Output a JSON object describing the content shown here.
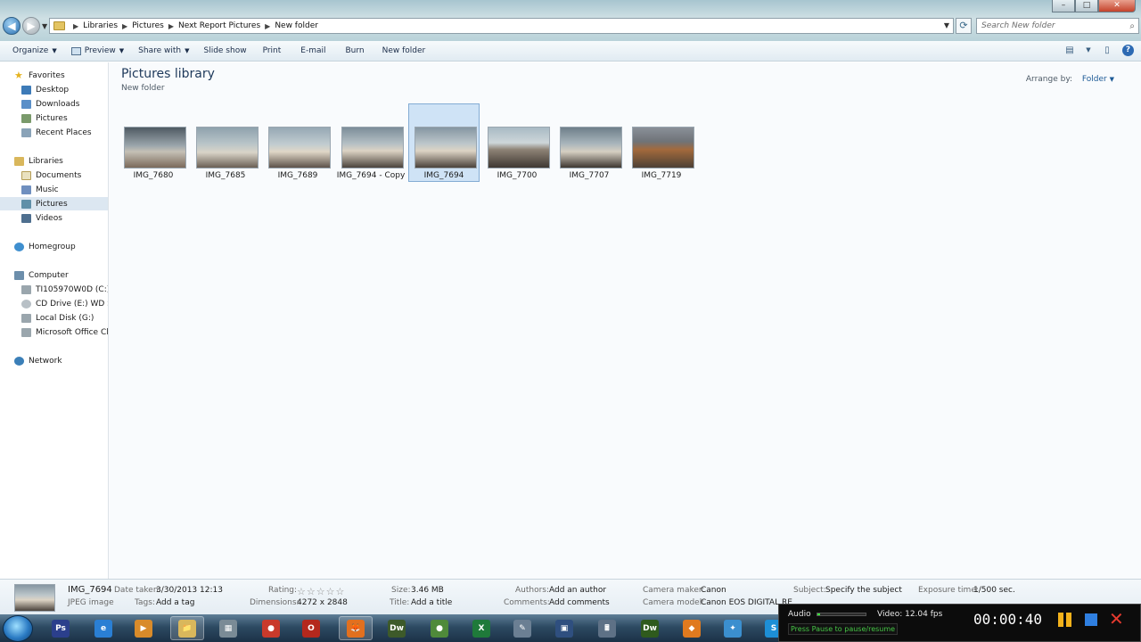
{
  "window": {
    "controls": [
      "–",
      "□",
      "✕"
    ]
  },
  "address": {
    "breadcrumbs": [
      "Libraries",
      "Pictures",
      "Next Report Pictures",
      "New folder"
    ],
    "search_placeholder": "Search New folder"
  },
  "toolbar": {
    "organize": "Organize",
    "preview": "Preview",
    "share_with": "Share with",
    "slide_show": "Slide show",
    "print": "Print",
    "email": "E-mail",
    "burn": "Burn",
    "new_folder": "New folder"
  },
  "sidebar": {
    "favorites": "Favorites",
    "favorites_items": [
      "Desktop",
      "Downloads",
      "Pictures",
      "Recent Places"
    ],
    "libraries": "Libraries",
    "libraries_items": [
      "Documents",
      "Music",
      "Pictures",
      "Videos"
    ],
    "homegroup": "Homegroup",
    "computer": "Computer",
    "computer_items": [
      "TI105970W0D (C:)",
      "CD Drive (E:) WD Sm",
      "Local Disk (G:)",
      "Microsoft Office Clic"
    ],
    "network": "Network"
  },
  "content": {
    "title": "Pictures library",
    "subtitle": "New folder",
    "arrange_label": "Arrange by:",
    "arrange_value": "Folder",
    "files": [
      "IMG_7680",
      "IMG_7685",
      "IMG_7689",
      "IMG_7694 - Copy",
      "IMG_7694",
      "IMG_7700",
      "IMG_7707",
      "IMG_7719"
    ],
    "selected": "IMG_7694"
  },
  "details": {
    "name": "IMG_7694",
    "type": "JPEG image",
    "date_taken_label": "Date taken:",
    "date_taken": "3/30/2013 12:13",
    "tags_label": "Tags:",
    "tags": "Add a tag",
    "rating_label": "Rating:",
    "rating_stars": "☆☆☆☆☆",
    "dimensions_label": "Dimensions:",
    "dimensions": "4272 x 2848",
    "size_label": "Size:",
    "size": "3.46 MB",
    "title_label": "Title:",
    "title": "Add a title",
    "authors_label": "Authors:",
    "authors": "Add an author",
    "comments_label": "Comments:",
    "comments": "Add comments",
    "camera_maker_label": "Camera maker:",
    "camera_maker": "Canon",
    "camera_model_label": "Camera model:",
    "camera_model": "Canon EOS DIGITAL RE",
    "subject_label": "Subject:",
    "subject": "Specify the subject",
    "exposure_label": "Exposure time:",
    "exposure": "1/500 sec."
  },
  "taskbar": {
    "apps": [
      "Ps",
      "e",
      "▶",
      "📁",
      "▦",
      "●",
      "O",
      "🦊",
      "Dw",
      "●",
      "X",
      "✎",
      "▣",
      "🖩",
      "Dw",
      "◆",
      "✦",
      "S"
    ]
  },
  "recorder": {
    "audio_label": "Audio",
    "audio_level": 0.05,
    "video_label": "Video: 12.04 fps",
    "hint": "Press Pause to pause/resume",
    "time": "00:00:40"
  }
}
